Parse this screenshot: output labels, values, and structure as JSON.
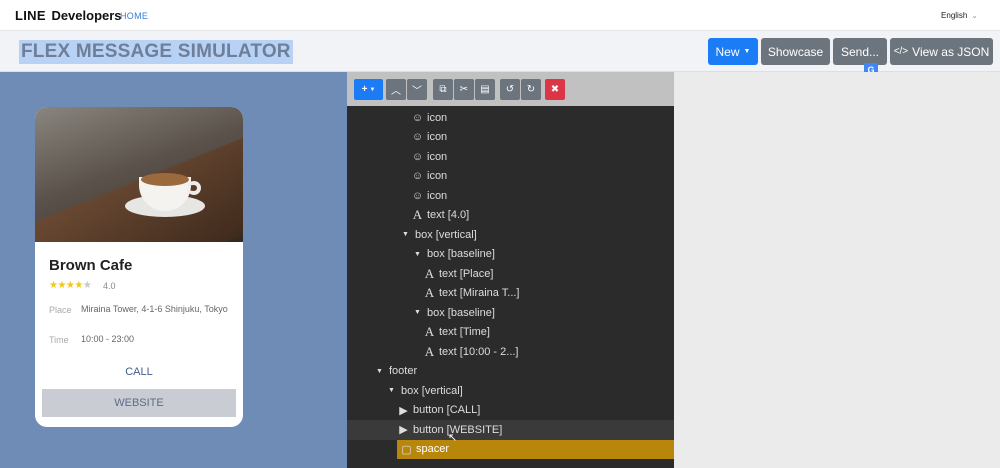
{
  "nav": {
    "brand_bold": "LINE",
    "brand_rest": "Developers",
    "home": "HOME",
    "language": "English"
  },
  "header": {
    "title": "FLEX MESSAGE SIMULATOR",
    "buttons": {
      "new": "New",
      "showcase": "Showcase",
      "send": "Send...",
      "view_json": "View as JSON"
    }
  },
  "preview": {
    "card_title": "Brown Cafe",
    "stars_on": "★★★★",
    "stars_off": "★",
    "rating": "4.0",
    "place_label": "Place",
    "place_value": "Miraina Tower, 4-1-6 Shinjuku, Tokyo",
    "time_label": "Time",
    "time_value": "10:00 - 23:00",
    "call": "CALL",
    "website": "WEBSITE"
  },
  "tree": [
    {
      "indent": 64,
      "icon": "smiley-icon",
      "glyph": "☺",
      "label": "icon"
    },
    {
      "indent": 64,
      "icon": "smiley-icon",
      "glyph": "☺",
      "label": "icon"
    },
    {
      "indent": 64,
      "icon": "smiley-icon",
      "glyph": "☺",
      "label": "icon"
    },
    {
      "indent": 64,
      "icon": "smiley-icon",
      "glyph": "☺",
      "label": "icon"
    },
    {
      "indent": 64,
      "icon": "smiley-icon",
      "glyph": "☺",
      "label": "icon"
    },
    {
      "indent": 64,
      "icon": "text-icon",
      "glyph": "A",
      "label": "text [4.0]"
    },
    {
      "indent": 52,
      "icon": "caret-down-icon",
      "glyph": "▼",
      "label": "box [vertical]"
    },
    {
      "indent": 64,
      "icon": "caret-down-icon",
      "glyph": "▼",
      "label": "box [baseline]"
    },
    {
      "indent": 76,
      "icon": "text-icon",
      "glyph": "A",
      "label": "text [Place]"
    },
    {
      "indent": 76,
      "icon": "text-icon",
      "glyph": "A",
      "label": "text [Miraina T...]"
    },
    {
      "indent": 64,
      "icon": "caret-down-icon",
      "glyph": "▼",
      "label": "box [baseline]"
    },
    {
      "indent": 76,
      "icon": "text-icon",
      "glyph": "A",
      "label": "text [Time]"
    },
    {
      "indent": 76,
      "icon": "text-icon",
      "glyph": "A",
      "label": "text [10:00 - 2...]"
    },
    {
      "indent": 26,
      "icon": "caret-down-icon",
      "glyph": "▼",
      "label": "footer"
    },
    {
      "indent": 38,
      "icon": "caret-down-icon",
      "glyph": "▼",
      "label": "box [vertical]"
    },
    {
      "indent": 50,
      "icon": "play-box-icon",
      "glyph": "▶",
      "label": "button [CALL]"
    },
    {
      "indent": 50,
      "icon": "play-box-icon",
      "glyph": "▶",
      "label": "button [WEBSITE]",
      "state": "hover"
    },
    {
      "indent": 50,
      "icon": "square-icon",
      "glyph": "▢",
      "label": "spacer",
      "state": "selected"
    }
  ]
}
